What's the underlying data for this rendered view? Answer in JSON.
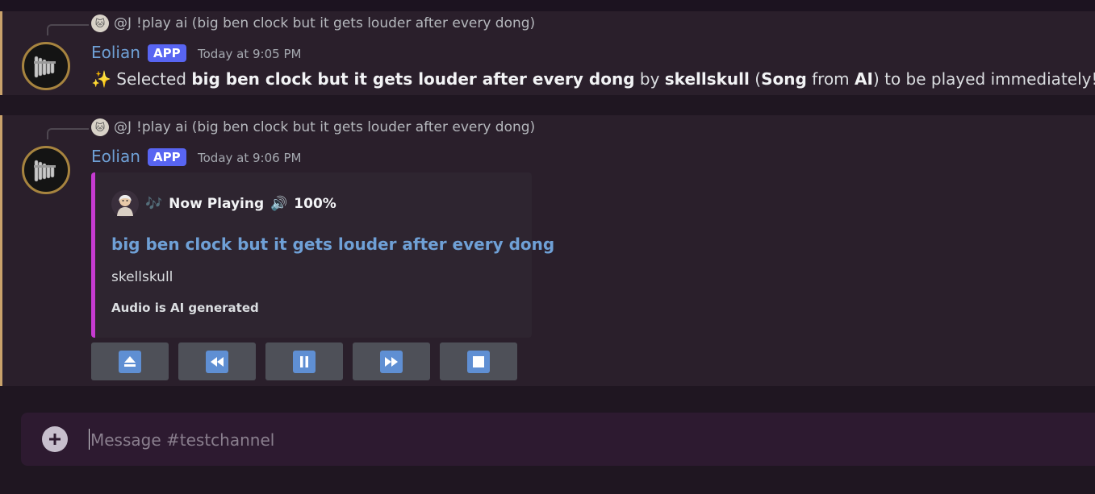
{
  "colors": {
    "accent_link": "#6fa0d6",
    "app_badge": "#5865f2",
    "embed_border": "#c63bd1",
    "message_bar": "#c9a26b"
  },
  "messages": [
    {
      "reply": {
        "author": "@J",
        "text": "!play ai (big ben clock but it gets louder after every dong)"
      },
      "username": "Eolian",
      "badge": "APP",
      "timestamp": "Today at 9:05 PM",
      "content": {
        "emoji": "✨",
        "prefix": "Selected ",
        "song": "big ben clock but it gets louder after every dong",
        "by": " by ",
        "artist": "skellskull",
        "open_paren": " (",
        "kind": "Song",
        "from": " from ",
        "source": "AI",
        "suffix": ") to be played immediately!"
      }
    },
    {
      "reply": {
        "author": "@J",
        "text": "!play ai (big ben clock but it gets louder after every dong)"
      },
      "username": "Eolian",
      "badge": "APP",
      "timestamp": "Today at 9:06 PM",
      "embed": {
        "author": "Now Playing",
        "music_icon": "🎶",
        "volume_icon": "🔊",
        "volume": "100%",
        "title": "big ben clock but it gets louder after every dong",
        "description": "skellskull",
        "footer": "Audio is AI generated"
      },
      "controls": [
        "eject-icon",
        "rewind-icon",
        "pause-icon",
        "fast-forward-icon",
        "stop-icon"
      ]
    }
  ],
  "composer": {
    "placeholder": "Message #testchannel"
  }
}
